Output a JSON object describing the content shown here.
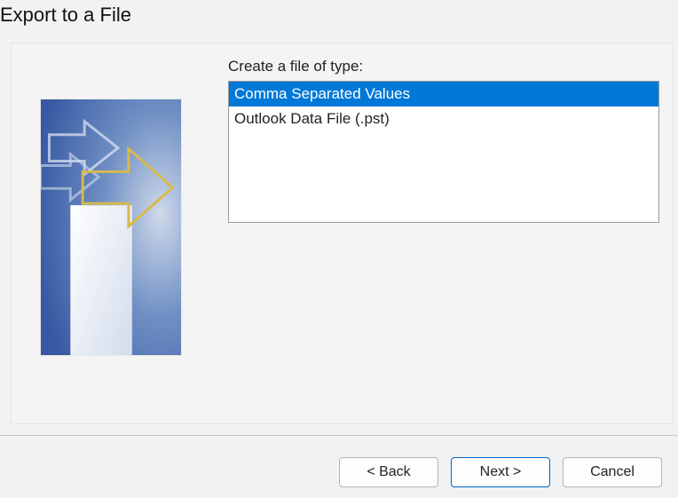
{
  "dialog": {
    "title": "Export to a File"
  },
  "form": {
    "file_type_label": "Create a file of type:",
    "options": [
      {
        "label": "Comma Separated Values",
        "selected": true
      },
      {
        "label": "Outlook Data File (.pst)",
        "selected": false
      }
    ]
  },
  "buttons": {
    "back": "< Back",
    "next": "Next >",
    "cancel": "Cancel"
  }
}
